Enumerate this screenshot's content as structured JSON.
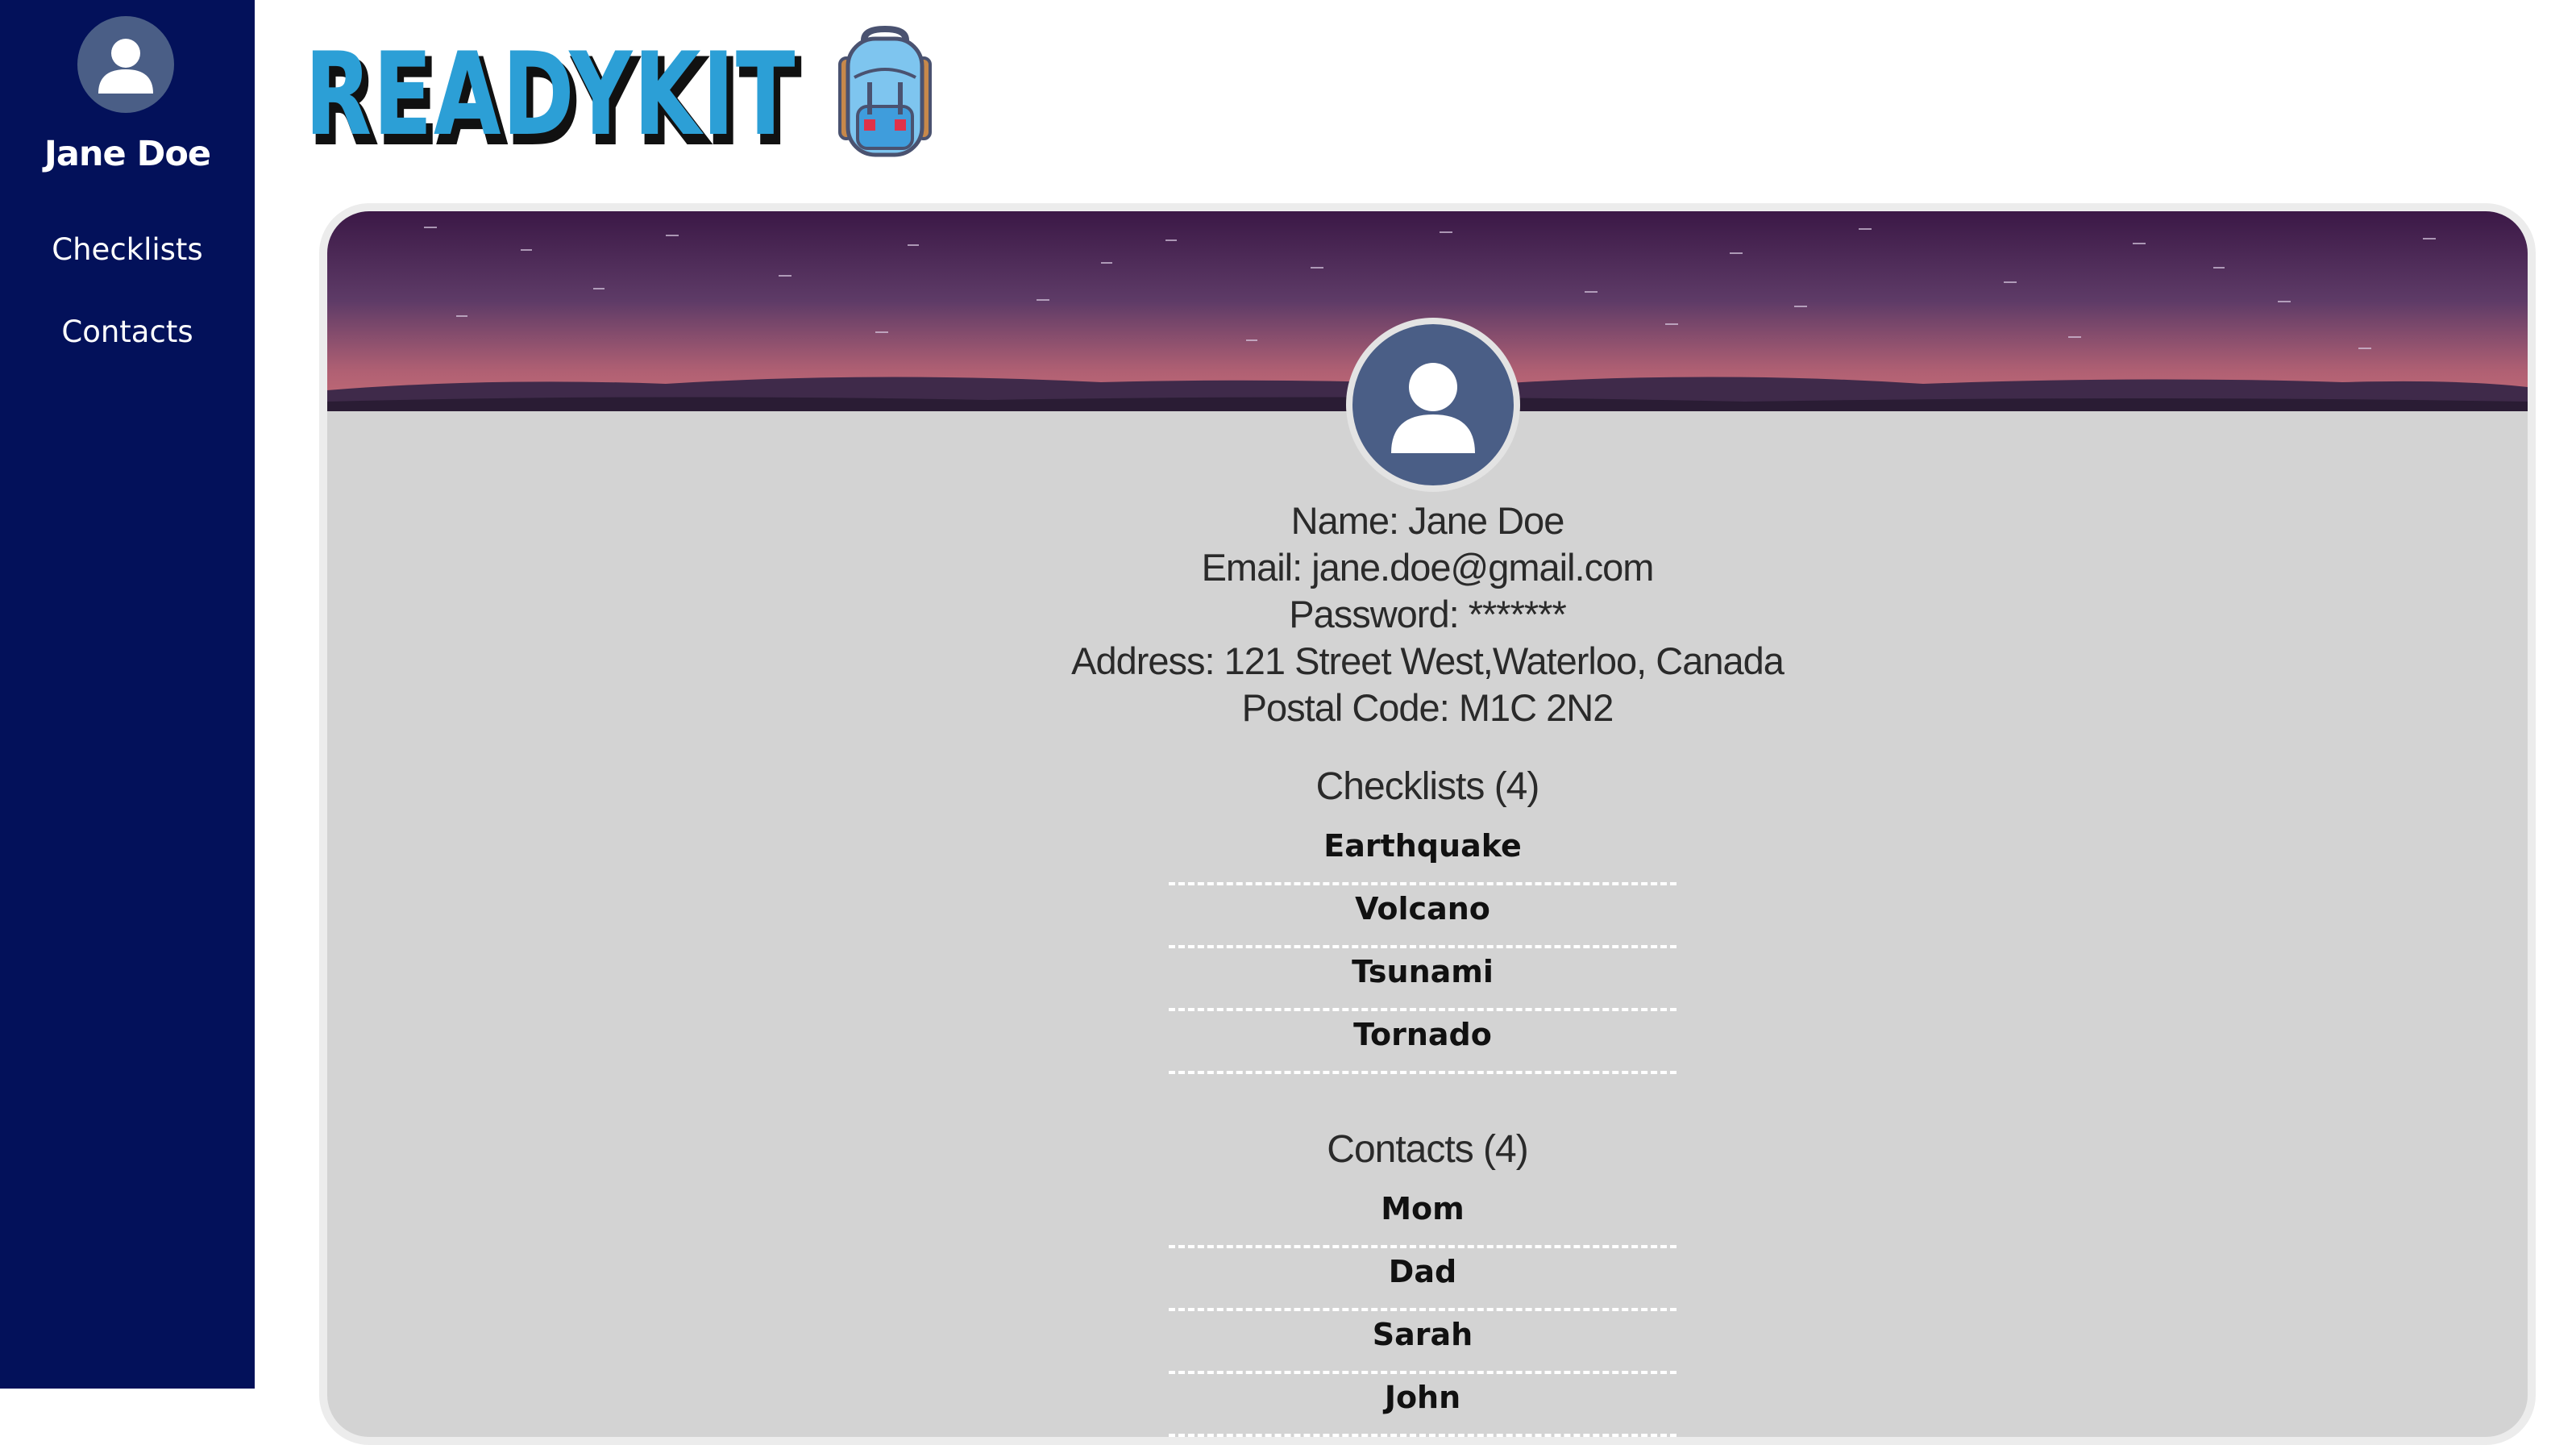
{
  "sidebar": {
    "user_name": "Jane Doe",
    "nav": [
      {
        "label": "Checklists"
      },
      {
        "label": "Contacts"
      }
    ],
    "bg_color": "#03115a"
  },
  "brand": {
    "logo_text": "READYKIT",
    "logo_icon": "backpack-icon"
  },
  "profile": {
    "name_line": "Name: Jane Doe",
    "email_line": "Email: jane.doe@gmail.com",
    "password_line": "Password: *******",
    "address_line": "Address: 121 Street West,Waterloo, Canada",
    "postal_line": "Postal Code: M1C 2N2"
  },
  "checklists": {
    "title": "Checklists (4)",
    "items": [
      "Earthquake",
      "Volcano",
      "Tsunami",
      "Tornado"
    ]
  },
  "contacts": {
    "title": "Contacts (4)",
    "items": [
      "Mom",
      "Dad",
      "Sarah",
      "John"
    ]
  }
}
